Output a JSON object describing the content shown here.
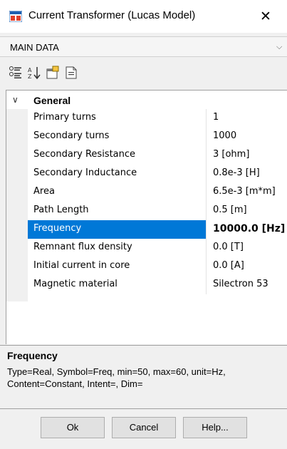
{
  "window": {
    "title": "Current Transformer (Lucas Model)",
    "close_glyph": "✕",
    "icon": "app-icon"
  },
  "section_selector": {
    "value": "MAIN DATA"
  },
  "toolbar": {
    "buttons": [
      "categorized-icon",
      "sort-alphabetical-icon",
      "property-pages-icon",
      "document-icon"
    ]
  },
  "grid": {
    "category": "General",
    "rows": [
      {
        "name": "Primary turns",
        "value": "1"
      },
      {
        "name": "Secondary turns",
        "value": "1000"
      },
      {
        "name": "Secondary Resistance",
        "value": "3 [ohm]"
      },
      {
        "name": "Secondary Inductance",
        "value": "0.8e-3 [H]"
      },
      {
        "name": "Area",
        "value": "6.5e-3 [m*m]"
      },
      {
        "name": "Path Length",
        "value": "0.5 [m]"
      },
      {
        "name": "Frequency",
        "value": "10000.0 [Hz]",
        "selected": true
      },
      {
        "name": "Remnant flux density",
        "value": "0.0 [T]"
      },
      {
        "name": "Initial current in core",
        "value": "0.0 [A]"
      },
      {
        "name": "Magnetic material",
        "value": "Silectron 53"
      }
    ]
  },
  "description": {
    "title": "Frequency",
    "body": "Type=Real, Symbol=Freq, min=50, max=60, unit=Hz, Content=Constant, Intent=, Dim="
  },
  "buttons": {
    "ok": "Ok",
    "cancel": "Cancel",
    "help": "Help..."
  },
  "colors": {
    "selection": "#0078d7"
  }
}
